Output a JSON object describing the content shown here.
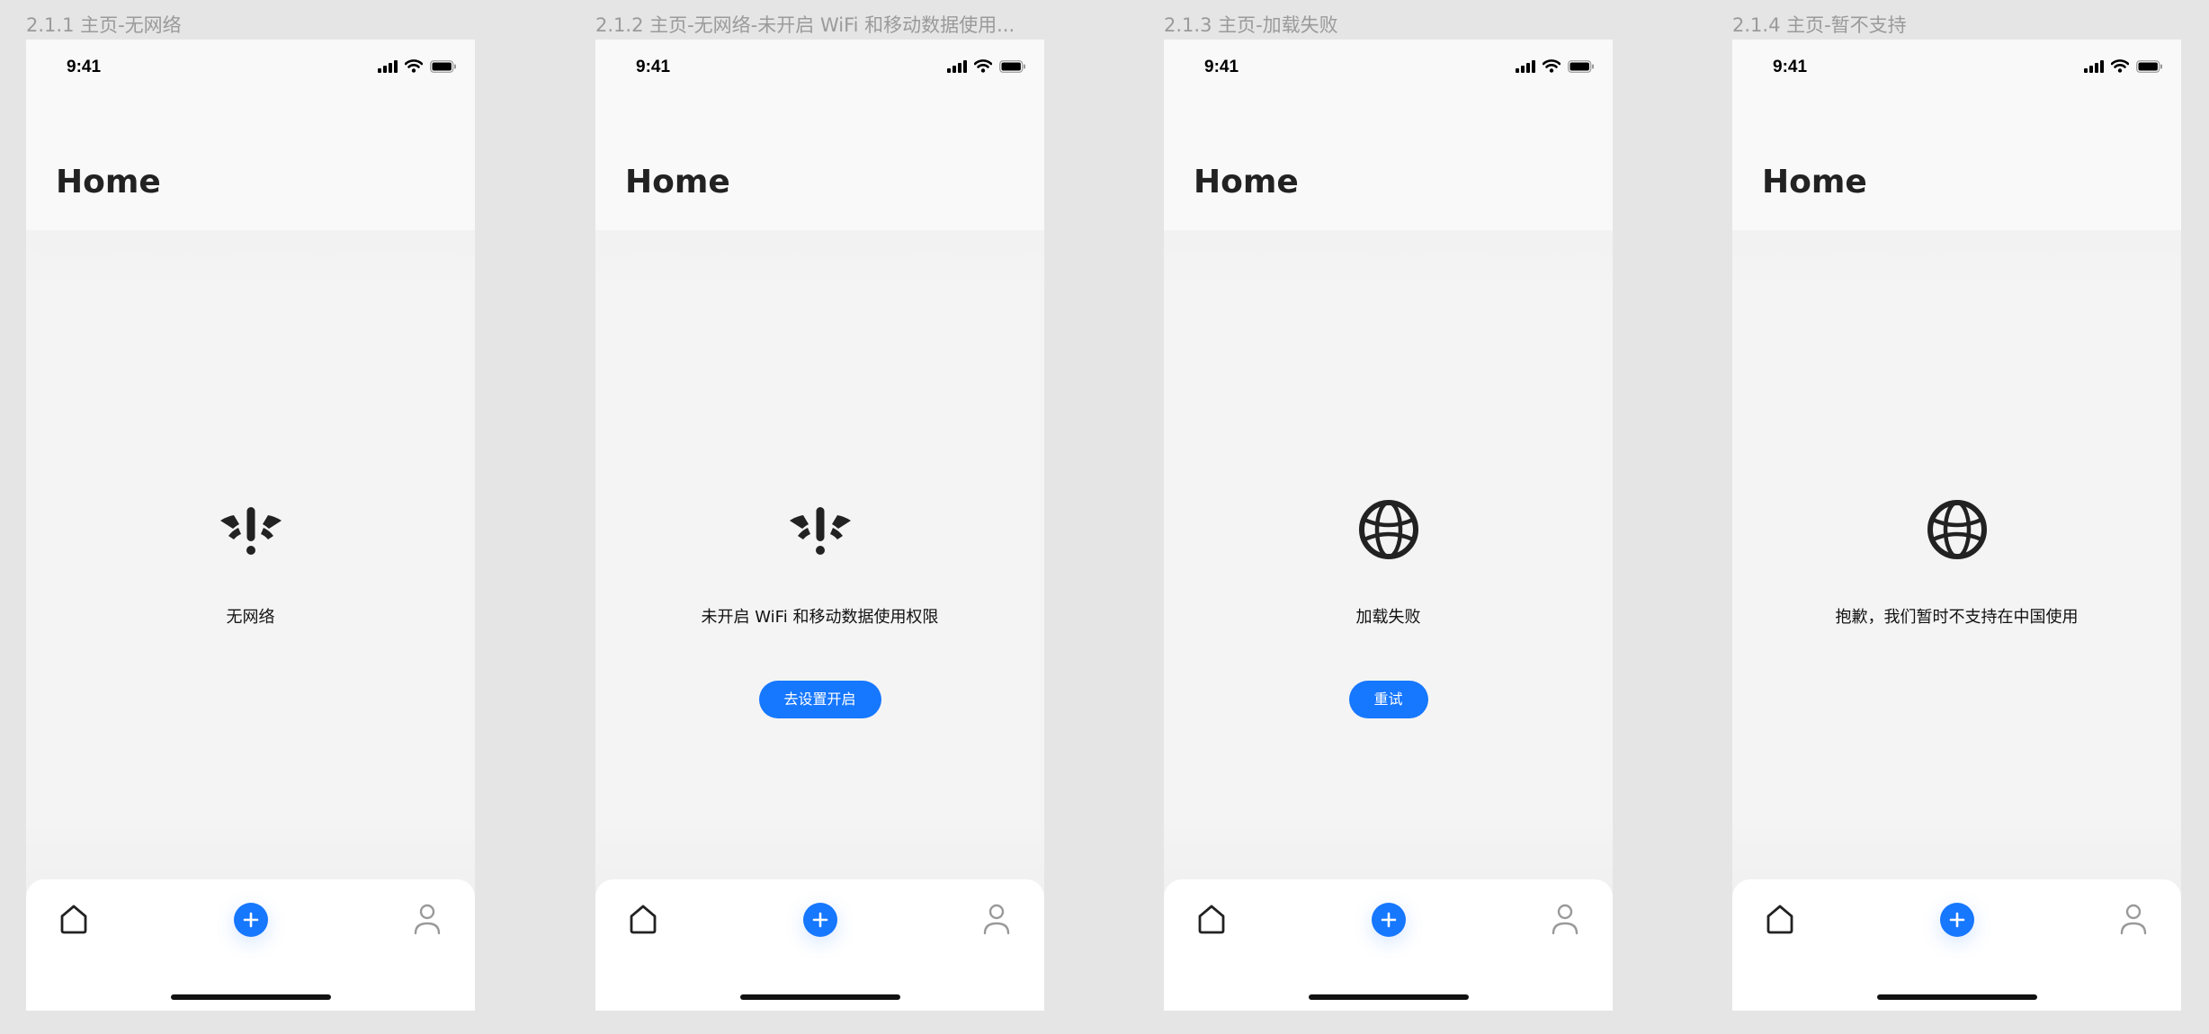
{
  "screens": [
    {
      "frame_title": "2.1.1 主页-无网络",
      "status_time": "9:41",
      "page_title": "Home",
      "state_icon": "wifi-off-icon",
      "message": "无网络",
      "button_label": null
    },
    {
      "frame_title": "2.1.2 主页-无网络-未开启 WiFi 和移动数据使用...",
      "status_time": "9:41",
      "page_title": "Home",
      "state_icon": "wifi-off-icon",
      "message": "未开启 WiFi 和移动数据使用权限",
      "button_label": "去设置开启"
    },
    {
      "frame_title": "2.1.3 主页-加载失败",
      "status_time": "9:41",
      "page_title": "Home",
      "state_icon": "globe-icon",
      "message": "加载失败",
      "button_label": "重试"
    },
    {
      "frame_title": "2.1.4 主页-暂不支持",
      "status_time": "9:41",
      "page_title": "Home",
      "state_icon": "globe-icon",
      "message": "抱歉，我们暂时不支持在中国使用",
      "button_label": null
    }
  ],
  "tab_bar": {
    "items": [
      {
        "icon": "home-icon"
      },
      {
        "icon": "add-icon"
      },
      {
        "icon": "profile-icon"
      }
    ]
  },
  "colors": {
    "accent": "#1677ff",
    "canvas": "#e5e5e5",
    "screen_background": "#f4f4f4",
    "header_background": "#f9f9f9"
  }
}
